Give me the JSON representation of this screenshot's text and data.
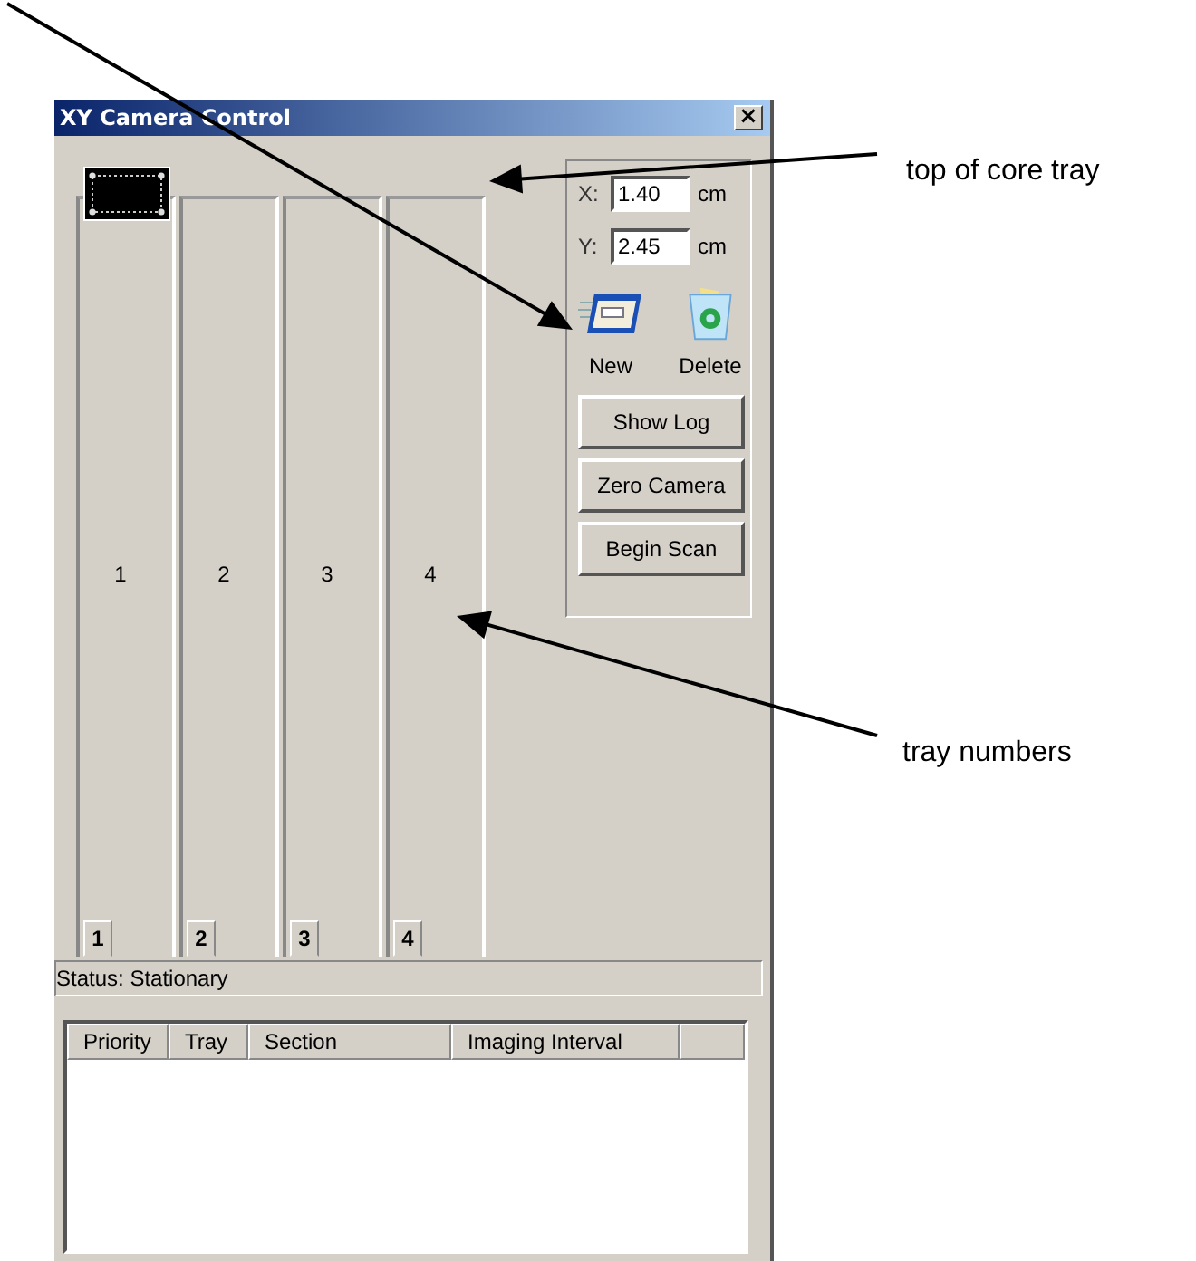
{
  "window": {
    "title": "XY Camera Control",
    "close": "×"
  },
  "trays": [
    {
      "number": "1",
      "tab": "1",
      "has_camera": true
    },
    {
      "number": "2",
      "tab": "2",
      "has_camera": false
    },
    {
      "number": "3",
      "tab": "3",
      "has_camera": false
    },
    {
      "number": "4",
      "tab": "4",
      "has_camera": false
    }
  ],
  "position": {
    "fields": [
      {
        "label": "X:",
        "value": "1.40",
        "unit": "cm"
      },
      {
        "label": "Y:",
        "value": "2.45",
        "unit": "cm"
      }
    ]
  },
  "actions": [
    {
      "kind": "new",
      "label": "New"
    },
    {
      "kind": "delete",
      "label": "Delete"
    }
  ],
  "buttons": [
    "Show Log",
    "Zero Camera",
    "Begin Scan"
  ],
  "status_bar": "Status: Stationary",
  "table": {
    "columns": [
      "Priority",
      "Tray",
      "Section",
      "Imaging Interval"
    ]
  },
  "annotations": [
    {
      "kind": "pointer"
    },
    {
      "kind": "callout",
      "label": "top of core tray"
    },
    {
      "kind": "callout",
      "label": "tray numbers"
    }
  ]
}
